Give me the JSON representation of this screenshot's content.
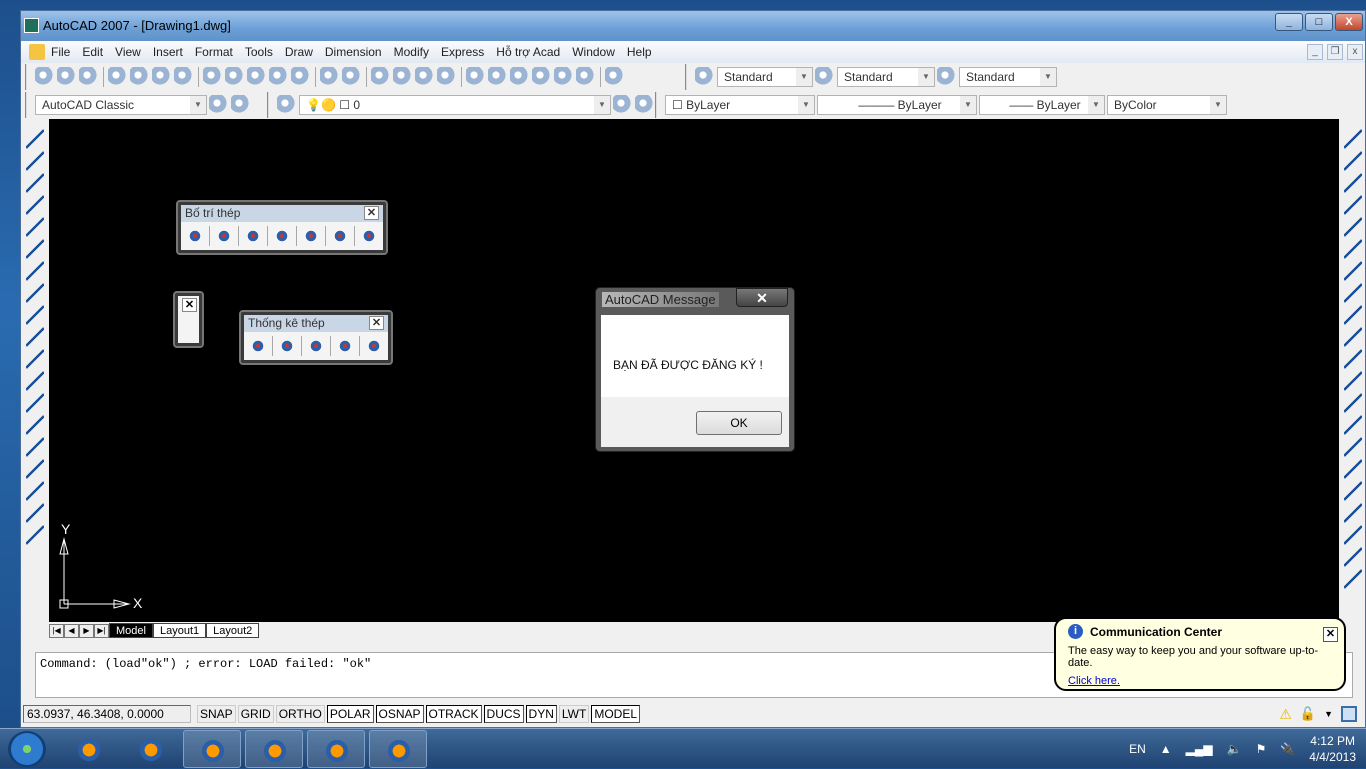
{
  "window": {
    "title": "AutoCAD 2007 - [Drawing1.dwg]",
    "controls": [
      "_",
      "□",
      "X"
    ]
  },
  "menu": {
    "items": [
      "File",
      "Edit",
      "View",
      "Insert",
      "Format",
      "Tools",
      "Draw",
      "Dimension",
      "Modify",
      "Express",
      "Hỗ trợ Acad",
      "Window",
      "Help"
    ]
  },
  "toolbar1": {
    "icons": [
      "new-icon",
      "open-icon",
      "save-icon",
      "plot-icon",
      "plot-preview-icon",
      "publish-icon",
      "web-icon",
      "cut-icon",
      "copy-icon",
      "paste-icon",
      "match-properties-icon",
      "block-editor-icon",
      "undo-icon",
      "redo-icon",
      "pan-icon",
      "zoom-realtime-icon",
      "zoom-window-icon",
      "zoom-previous-icon",
      "properties-icon",
      "design-center-icon",
      "tool-palettes-icon",
      "sheet-set-icon",
      "markup-icon",
      "quickcalc-icon",
      "help-icon"
    ],
    "text_style": "Standard",
    "dim_style": "Standard",
    "table_style": "Standard"
  },
  "toolbar2": {
    "workspace": "AutoCAD Classic",
    "layer": "0",
    "color": "ByLayer",
    "linetype": "ByLayer",
    "lineweight": "ByLayer",
    "plotstyle": "ByColor"
  },
  "left_toolbar": {
    "icons": [
      "line-icon",
      "construction-line-icon",
      "polyline-icon",
      "polygon-icon",
      "rectangle-icon",
      "arc-icon",
      "circle-icon",
      "revision-cloud-icon",
      "spline-icon",
      "ellipse-icon",
      "ellipse-arc-icon",
      "insert-block-icon",
      "make-block-icon",
      "point-icon",
      "hatch-icon",
      "gradient-icon",
      "region-icon",
      "table-icon",
      "multiline-text-icon"
    ]
  },
  "right_toolbar": {
    "icons": [
      "erase-icon",
      "copy-object-icon",
      "mirror-icon",
      "offset-icon",
      "array-icon",
      "move-icon",
      "rotate-icon",
      "scale-icon",
      "stretch-icon",
      "trim-icon",
      "extend-icon",
      "break-at-point-icon",
      "break-icon",
      "join-icon",
      "chamfer-icon",
      "fillet-icon",
      "explode-icon",
      "draworder-icon",
      "draworder-front-icon",
      "draworder-back-icon",
      "draworder-above-icon"
    ]
  },
  "float_bo_tri_thep": {
    "title": "Bố trí thép",
    "icons": [
      "rebar-icon",
      "dimension-line-icon",
      "section-icon",
      "label-abcd-icon",
      "back-arrow-icon",
      "table-grid-icon",
      "schedule-icon"
    ]
  },
  "float_thong_ke_thep": {
    "title": "Thống kê thép",
    "icons": [
      "frame-icon",
      "abc-text-icon",
      "replace-text-icon",
      "find-icon",
      "no-icon"
    ]
  },
  "message": {
    "title": "AutoCAD Message",
    "text": "BẠN ĐÃ ĐƯỢC ĐĂNG KÝ !",
    "ok": "OK"
  },
  "ucs": {
    "x": "X",
    "y": "Y"
  },
  "tabs": [
    "Model",
    "Layout1",
    "Layout2"
  ],
  "command": {
    "line": "Command: (load\"ok\") ; error: LOAD failed: \"ok\""
  },
  "status": {
    "coords": "63.0937, 46.3408, 0.0000",
    "buttons": [
      {
        "label": "SNAP",
        "on": false
      },
      {
        "label": "GRID",
        "on": false
      },
      {
        "label": "ORTHO",
        "on": false
      },
      {
        "label": "POLAR",
        "on": true
      },
      {
        "label": "OSNAP",
        "on": true
      },
      {
        "label": "OTRACK",
        "on": true
      },
      {
        "label": "DUCS",
        "on": true
      },
      {
        "label": "DYN",
        "on": true
      },
      {
        "label": "LWT",
        "on": false
      },
      {
        "label": "MODEL",
        "on": true
      }
    ]
  },
  "balloon": {
    "title": "Communication Center",
    "body": "The easy way to keep you and your software up-to-date.",
    "link": "Click here."
  },
  "taskbar": {
    "apps": [
      "media-player-icon",
      "internet-explorer-icon",
      "file-explorer-icon",
      "firefox-icon",
      "autocad-icon",
      "paint-icon"
    ],
    "language": "EN",
    "time": "4:12 PM",
    "date": "4/4/2013"
  }
}
